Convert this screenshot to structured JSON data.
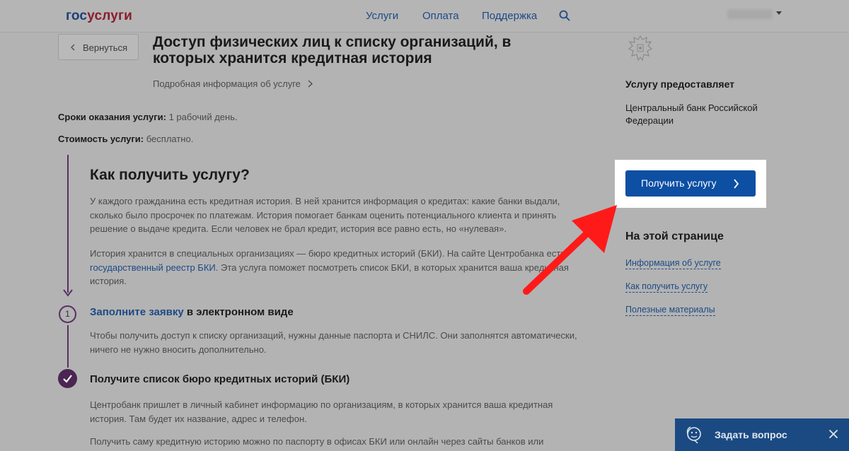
{
  "header": {
    "logo_part1": "гос",
    "logo_part2": "услуги",
    "nav": [
      "Услуги",
      "Оплата",
      "Поддержка"
    ]
  },
  "back_label": "Вернуться",
  "title": "Доступ физических лиц к списку организаций, в которых хранится кредитная история",
  "details_link": "Подробная информация об услуге",
  "meta": {
    "term_label": "Сроки оказания услуги:",
    "term_value": "1 рабочий день.",
    "cost_label": "Стоимость услуги:",
    "cost_value": "бесплатно."
  },
  "how": {
    "heading": "Как получить услугу?",
    "para1": "У каждого гражданина есть кредитная история. В ней хранится информация о кредитах: какие банки выдали, сколько было просрочек по платежам. История помогает банкам оценить потенциального клиента и принять решение о выдаче кредита. Если человек не брал кредит, история все равно есть, но «нулевая».",
    "para2_start": "История хранится в специальных организациях — бюро кредитных историй (БКИ). На сайте Центробанка есть ",
    "para2_link": "государственный реестр БКИ",
    "para2_end": ". Эта услуга поможет посмотреть список БКИ, в которых хранится ваша кредитная история."
  },
  "step1": {
    "number": "1",
    "title_link": "Заполните заявку",
    "title_rest": " в электронном виде",
    "text": "Чтобы получить доступ к списку организаций, нужны данные паспорта и СНИЛС. Они заполнятся автоматически, ничего не нужно вносить дополнительно."
  },
  "step2": {
    "title": "Получите список бюро кредитных историй (БКИ)",
    "text1": "Центробанк пришлет в личный кабинет информацию по организациям, в которых хранится ваша кредитная история. Там будет их название, адрес и телефон.",
    "text2": "Получить саму кредитную историю можно по паспорту в офисах БКИ или онлайн через сайты банков или"
  },
  "sidebar": {
    "provider_heading": "Услугу предоставляет",
    "provider_name": "Центральный банк Российской Федерации",
    "cta_label": "Получить услугу",
    "onpage_heading": "На этой странице",
    "onpage_links": [
      "Информация об услуге",
      "Как получить услугу",
      "Полезные материалы"
    ]
  },
  "ask_widget": {
    "label": "Задать вопрос"
  },
  "colors": {
    "primary": "#0d4fa3",
    "link": "#1d4a86",
    "timeline": "#5a2f63",
    "annotation_arrow": "#ff1a1a"
  }
}
